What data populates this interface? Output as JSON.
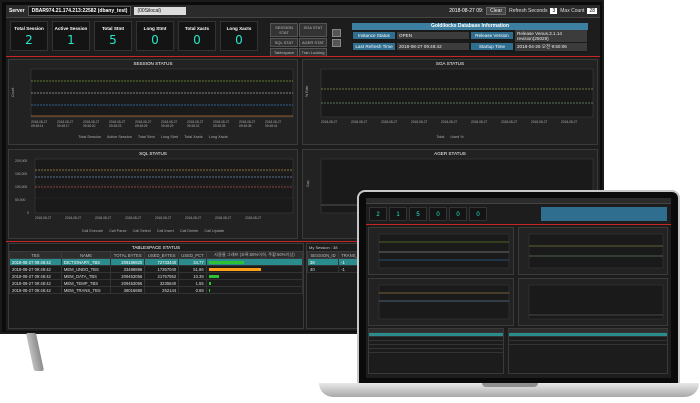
{
  "topbar": {
    "server_label": "Server",
    "server_value": "DBAR974.21.174.213:22582 (dbany_test)",
    "select_value": "(00Silocal)",
    "datetime": "2018-08-27 09:",
    "clear_label": "Clear",
    "refresh_label": "Refresh Seconds",
    "refresh_value": "3",
    "max_count_label": "Max Count",
    "max_count_value": "28"
  },
  "stats": [
    {
      "title": "Total Session",
      "value": "2"
    },
    {
      "title": "Active Session",
      "value": "1"
    },
    {
      "title": "Total Stmt",
      "value": "5"
    },
    {
      "title": "Long Stmt",
      "value": "0"
    },
    {
      "title": "Total Xacts",
      "value": "0"
    },
    {
      "title": "Long Xacts",
      "value": "0"
    }
  ],
  "mid_buttons": [
    "SESSION STAT",
    "SGA STAT",
    "SQL STAT",
    "AGER STAT",
    "Tablespace",
    "Tran Locking"
  ],
  "db_info": {
    "title": "Goldilocks Database Information",
    "instance_status_label": "Instance Status",
    "instance_status": "OPEN",
    "release_version_label": "Release Version",
    "release_version": "Release Venus.3.1.14 revision(25029)",
    "last_refresh_label": "Last Refresh Time",
    "last_refresh": "2018-08-27 09:48:42",
    "startup_label": "Startup Time",
    "startup": "2018-04-26 오전 9:50:06"
  },
  "session_chart": {
    "title": "SESSION STATUS",
    "ylabel": "Count",
    "x_ticks": [
      "2018-08-27\n09:48:14",
      "2018-08-27\n09:48:17",
      "2018-08-27\n09:48:20",
      "2018-08-27\n09:48:23",
      "2018-08-27\n09:48:26",
      "2018-08-27\n09:48:29",
      "2018-08-27\n09:48:32",
      "2018-08-27\n09:48:35",
      "2018-08-27\n09:48:38",
      "2018-08-27\n09:48:41"
    ],
    "legend": [
      "Total Session",
      "Active Session",
      "Total Stmt",
      "Long Stmt",
      "Total Xacts",
      "Long Xacts"
    ],
    "colors": [
      "#9acd32",
      "#e0e0e0",
      "#3aa0ff",
      "#ff9933",
      "#cc66cc",
      "#66cccc"
    ]
  },
  "sga_chart": {
    "title": "SGA STATUS",
    "ylabel": "% Rate",
    "legend": [
      "Total",
      "Used %"
    ],
    "colors": [
      "#cccc66",
      "#99cc99"
    ]
  },
  "sql_chart": {
    "title": "SQL STATUS",
    "y_ticks": [
      "200,000",
      "150,000",
      "100,000",
      "50,000",
      "0"
    ],
    "ylabel": "Statistic Value",
    "legend": [
      "Call Execute",
      "Call Parse",
      "Call Select",
      "Call Insert",
      "Call Delete",
      "Call Update"
    ],
    "colors": [
      "#ffcc66",
      "#99ccff",
      "#ff6666",
      "#66cc99",
      "#cc99ff",
      "#ffffff"
    ]
  },
  "ager_chart": {
    "title": "AGER STATUS",
    "ylabel": "Gap",
    "legend": [
      "Gap"
    ]
  },
  "tablespace": {
    "title": "TABLESPACE STATUS",
    "columns": [
      "TBS",
      "NAME",
      "TOTAL BYTES",
      "USED_BYTES",
      "USED_PCT",
      "사용율 그래프 (초록:50%이하, 주황:50%이상)"
    ],
    "rows": [
      {
        "time": "2018-08-27 09:48:42",
        "name": "DICTIONARY_TBS",
        "total": "209199820",
        "used": "72733440",
        "pct": "34.77",
        "fill": 0.35,
        "color": "#2cc236",
        "hl": true
      },
      {
        "time": "2018-08-27 09:48:42",
        "name": "MEM_UNDO_TBS",
        "total": "33488896",
        "used": "17367040",
        "pct": "51.86",
        "fill": 0.52,
        "color": "#ff9f1a",
        "hl": false
      },
      {
        "time": "2018-08-27 09:48:42",
        "name": "MEM_DATA_TBS",
        "total": "209453056",
        "used": "21757952",
        "pct": "10.39",
        "fill": 0.1,
        "color": "#2cc236",
        "hl": false
      },
      {
        "time": "2018-08-27 09:48:42",
        "name": "MEM_TEMP_TBS",
        "total": "209453056",
        "used": "3235840",
        "pct": "1.55",
        "fill": 0.02,
        "color": "#2cc236",
        "hl": false
      },
      {
        "time": "2018-08-27 09:48:42",
        "name": "MEM_TRANS_TBS",
        "total": "36016680",
        "used": "252144",
        "pct": "0.69",
        "fill": 0.01,
        "color": "#2cc236",
        "hl": false
      }
    ]
  },
  "session_side": {
    "title": "My Session : 38",
    "columns": [
      "SESSION_ID",
      "TRANS_ID"
    ],
    "rows": [
      [
        "38",
        "-1"
      ],
      [
        "40",
        "-1"
      ]
    ]
  }
}
